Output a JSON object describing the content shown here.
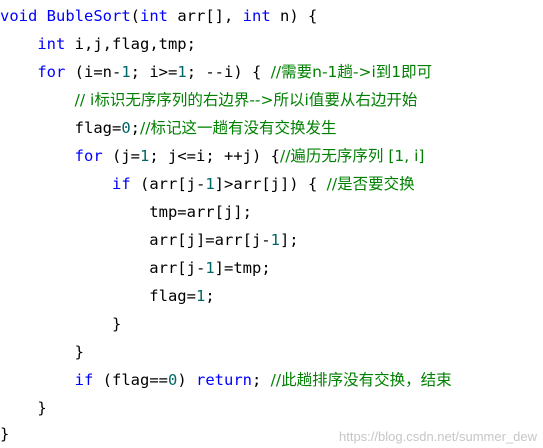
{
  "code": {
    "lines": [
      {
        "tokens": [
          {
            "t": "void ",
            "c": "kw"
          },
          {
            "t": "BubleSort",
            "c": "fn"
          },
          {
            "t": "(",
            "c": "op"
          },
          {
            "t": "int",
            "c": "kw"
          },
          {
            "t": " arr[], ",
            "c": "op"
          },
          {
            "t": "int",
            "c": "kw"
          },
          {
            "t": " n) {",
            "c": "op"
          }
        ]
      },
      {
        "tokens": [
          {
            "t": "    ",
            "c": "op"
          },
          {
            "t": "int",
            "c": "kw"
          },
          {
            "t": " i,j,flag,tmp;",
            "c": "op"
          }
        ]
      },
      {
        "tokens": [
          {
            "t": "    ",
            "c": "op"
          },
          {
            "t": "for",
            "c": "kw"
          },
          {
            "t": " (i=n-",
            "c": "op"
          },
          {
            "t": "1",
            "c": "num"
          },
          {
            "t": "; i>=",
            "c": "op"
          },
          {
            "t": "1",
            "c": "num"
          },
          {
            "t": "; --i) { ",
            "c": "op"
          },
          {
            "t": "//需要n-1趟->i到1即可",
            "c": "cm"
          }
        ]
      },
      {
        "tokens": [
          {
            "t": "        ",
            "c": "op"
          },
          {
            "t": "// i标识无序序列的右边界-->所以i值要从右边开始",
            "c": "cm"
          }
        ]
      },
      {
        "tokens": [
          {
            "t": "        flag=",
            "c": "op"
          },
          {
            "t": "0",
            "c": "num"
          },
          {
            "t": ";",
            "c": "op"
          },
          {
            "t": "//标记这一趟有没有交换发生",
            "c": "cm"
          }
        ]
      },
      {
        "tokens": [
          {
            "t": "        ",
            "c": "op"
          },
          {
            "t": "for",
            "c": "kw"
          },
          {
            "t": " (j=",
            "c": "op"
          },
          {
            "t": "1",
            "c": "num"
          },
          {
            "t": "; j<=i; ++j) {",
            "c": "op"
          },
          {
            "t": "//遍历无序序列 [1, i]",
            "c": "cm"
          }
        ]
      },
      {
        "tokens": [
          {
            "t": "            ",
            "c": "op"
          },
          {
            "t": "if",
            "c": "kw"
          },
          {
            "t": " (arr[j-",
            "c": "op"
          },
          {
            "t": "1",
            "c": "num"
          },
          {
            "t": "]>arr[j]) { ",
            "c": "op"
          },
          {
            "t": "//是否要交换",
            "c": "cm"
          }
        ]
      },
      {
        "tokens": [
          {
            "t": "                tmp=arr[j];",
            "c": "op"
          }
        ]
      },
      {
        "tokens": [
          {
            "t": "                arr[j]=arr[j-",
            "c": "op"
          },
          {
            "t": "1",
            "c": "num"
          },
          {
            "t": "];",
            "c": "op"
          }
        ]
      },
      {
        "tokens": [
          {
            "t": "                arr[j-",
            "c": "op"
          },
          {
            "t": "1",
            "c": "num"
          },
          {
            "t": "]=tmp;",
            "c": "op"
          }
        ]
      },
      {
        "tokens": [
          {
            "t": "                flag=",
            "c": "op"
          },
          {
            "t": "1",
            "c": "num"
          },
          {
            "t": ";",
            "c": "op"
          }
        ]
      },
      {
        "tokens": [
          {
            "t": "            }",
            "c": "op"
          }
        ]
      },
      {
        "tokens": [
          {
            "t": "        }",
            "c": "op"
          }
        ]
      },
      {
        "tokens": [
          {
            "t": "        ",
            "c": "op"
          },
          {
            "t": "if",
            "c": "kw"
          },
          {
            "t": " (flag==",
            "c": "op"
          },
          {
            "t": "0",
            "c": "num"
          },
          {
            "t": ") ",
            "c": "op"
          },
          {
            "t": "return",
            "c": "kw"
          },
          {
            "t": "; ",
            "c": "op"
          },
          {
            "t": "//此趟排序没有交换，结束",
            "c": "cm"
          }
        ]
      },
      {
        "tokens": [
          {
            "t": "    }",
            "c": "op"
          }
        ]
      },
      {
        "tokens": [
          {
            "t": "}",
            "c": "op"
          }
        ]
      }
    ]
  },
  "watermark": "https://blog.csdn.net/summer_dew",
  "colors": {
    "keyword": "#0000ff",
    "comment": "#008000",
    "number": "#006666",
    "text": "#000000"
  }
}
